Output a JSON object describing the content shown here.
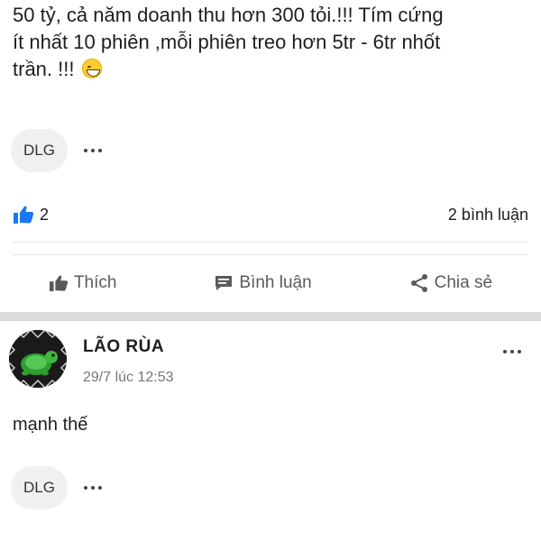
{
  "post": {
    "text_line1": "50 tỷ, cả năm doanh thu hơn 300 tỏi.!!! Tím cứng",
    "text_line2": "ít nhất 10 phiên ,mỗi phiên treo hơn 5tr - 6tr nhốt",
    "text_line3": "trần. !!!",
    "emoji": "grinning-sweat-emoji",
    "tag": "DLG",
    "like_count": "2",
    "comment_count": "2 bình luận",
    "actions": {
      "like": "Thích",
      "comment": "Bình luận",
      "share": "Chia sẻ"
    }
  },
  "next_post": {
    "author": "LÃO RÙA",
    "time": "29/7 lúc 12:53",
    "text": "mạnh thế",
    "tag": "DLG",
    "avatar": "turtle-avatar"
  },
  "colors": {
    "like_blue": "#1877f2",
    "action_gray": "#5a5a5a",
    "divider": "#dcdcdc"
  }
}
